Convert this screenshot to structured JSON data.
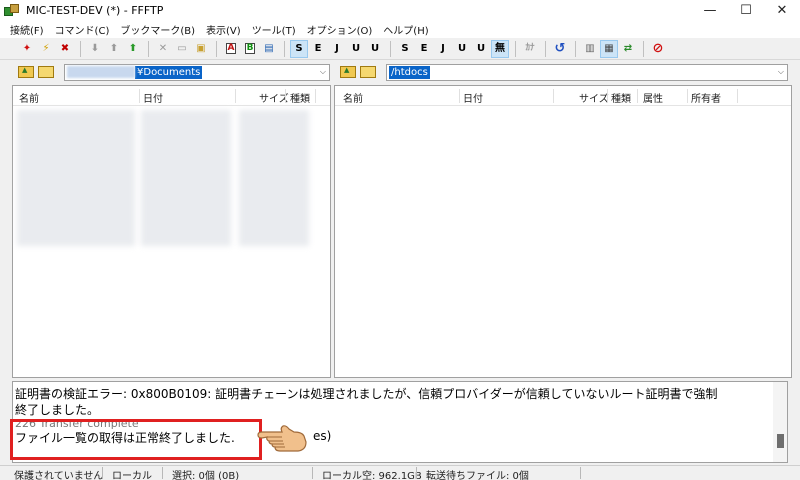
{
  "window": {
    "title": "MIC-TEST-DEV (*) - FFFTP",
    "minimize": "—",
    "maximize": "☐",
    "close": "✕"
  },
  "menu": [
    "接続(F)",
    "コマンド(C)",
    "ブックマーク(B)",
    "表示(V)",
    "ツール(T)",
    "オプション(O)",
    "ヘルプ(H)"
  ],
  "toolbar": {
    "connect": "✦",
    "quick_connect": "⚡",
    "disconnect": "✖",
    "download": "⬇",
    "upload": "⬆",
    "mirror_upload": "⬆",
    "delete": "✕",
    "rename": "▭",
    "mkdir": "▣",
    "mode_ascii": "A",
    "mode_binary": "B",
    "mode_auto": "▤",
    "remote_kanji": [
      "S",
      "E",
      "J",
      "U",
      "U"
    ],
    "local_kanji": [
      "S",
      "E",
      "J",
      "U",
      "U"
    ],
    "no_convert": "無",
    "kana": "ｶﾅ",
    "refresh": "↺",
    "list_view": "▥",
    "detail_view": "▦",
    "sync_folders": "⇄",
    "stop": "⊘"
  },
  "local": {
    "path": "¥Documents",
    "columns": [
      "名前",
      "日付",
      "サイズ",
      "種類"
    ]
  },
  "remote": {
    "path": "/htdocs",
    "columns": [
      "名前",
      "日付",
      "サイズ",
      "種類",
      "属性",
      "所有者"
    ]
  },
  "log": {
    "line1": "証明書の検証エラー: 0x800B0109: 証明書チェーンは処理されましたが、信頼プロバイダーが信頼していないルート証明書で強制",
    "line2": "終了しました。",
    "line3": "226 Transfer complete",
    "line4": "ファイル一覧の取得は正常終了しました.",
    "line4_tail": "es)"
  },
  "status": {
    "security": "保護されていません",
    "mode": "ローカル",
    "selected": "選択: 0個 (0B)",
    "local_free": "ローカル空: 962.1GB",
    "queue": "転送待ちファイル: 0個"
  },
  "colors": {
    "highlight_border": "#e02020",
    "selection": "#0a64c8"
  }
}
